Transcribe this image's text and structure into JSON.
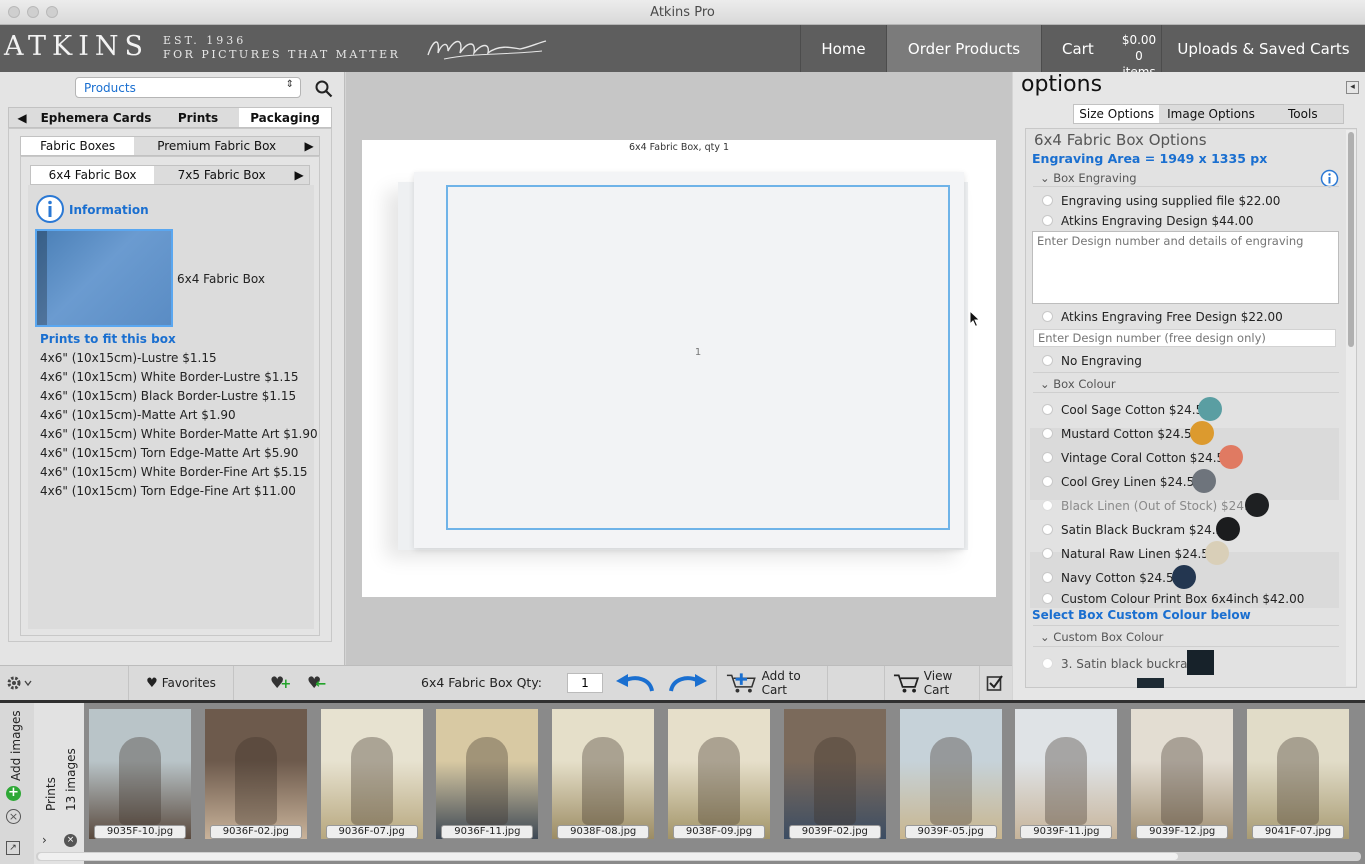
{
  "window": {
    "title": "Atkins Pro"
  },
  "header": {
    "logo": "ATKINS",
    "tagline1": "EST. 1936",
    "tagline2": "FOR PICTURES THAT MATTER",
    "nav": {
      "home": "Home",
      "order": "Order Products",
      "cart": "Cart",
      "cart_total": "$0.00",
      "cart_items": "0 items",
      "uploads": "Uploads & Saved Carts"
    }
  },
  "left": {
    "category_select": "Products",
    "top_tabs": [
      "Ephemera Cards",
      "Prints",
      "Packaging"
    ],
    "sub_tabs": [
      "Fabric Boxes",
      "Premium Fabric Box"
    ],
    "size_tabs": [
      "6x4 Fabric Box",
      "7x5 Fabric  Box"
    ],
    "info_label": "Information",
    "product_name": "6x4 Fabric Box",
    "prints_heading": "Prints to fit this box",
    "prints": [
      "4x6\" (10x15cm)-Lustre $1.15",
      "4x6\" (10x15cm) White Border-Lustre $1.15",
      "4x6\" (10x15cm) Black Border-Lustre $1.15",
      "4x6\" (10x15cm)-Matte Art $1.90",
      "4x6\" (10x15cm) White Border-Matte Art $1.90",
      "4x6\" (10x15cm) Torn Edge-Matte Art $5.90",
      "4x6\" (10x15cm) White Border-Fine Art $5.15",
      "4x6\" (10x15cm) Torn Edge-Fine Art $11.00"
    ],
    "favorites": "Favorites"
  },
  "center": {
    "caption": "6x4 Fabric Box, qty 1",
    "slot_number": "1"
  },
  "toolbar": {
    "qty_label": "6x4 Fabric Box Qty:",
    "qty_value": "1",
    "add_to_cart": "Add to Cart",
    "view_cart": "View Cart"
  },
  "options": {
    "title": "options",
    "tabs": [
      "Size Options",
      "Image Options",
      "Tools"
    ],
    "heading": "6x4 Fabric Box Options",
    "engraving_area": "Engraving Area = 1949 x 1335 px",
    "section_engraving": "Box Engraving",
    "engraving": [
      "Engraving using supplied file $22.00",
      "Atkins Engraving Design $44.00"
    ],
    "engraving_placeholder": "Enter Design number and details of engraving",
    "free_design": "Atkins Engraving Free Design $22.00",
    "free_placeholder": "Enter Design number (free design only)",
    "no_engraving": "No Engraving",
    "section_colour": "Box Colour",
    "colours": [
      {
        "label": "Cool Sage Cotton $24.50",
        "color": "#5a9ea2"
      },
      {
        "label": "Mustard Cotton $24.50",
        "color": "#dc9a2e"
      },
      {
        "label": "Vintage Coral Cotton $24.50",
        "color": "#e07a62"
      },
      {
        "label": "Cool Grey Linen $24.50",
        "color": "#6e747c"
      },
      {
        "label": "Black Linen (Out of Stock) $24.50",
        "color": "#1e2022"
      },
      {
        "label": "Satin Black Buckram $24.50",
        "color": "#1b1c1e"
      },
      {
        "label": "Natural Raw Linen $24.50",
        "color": "#d9cfb8"
      },
      {
        "label": "Navy Cotton $24.50",
        "color": "#233650"
      }
    ],
    "custom_print": "Custom Colour Print Box 6x4inch $42.00",
    "custom_select": "Select Box Custom Colour below",
    "section_custom": "Custom Box Colour",
    "custom_item": "3. Satin black buckram"
  },
  "filmstrip": {
    "add_images": "Add images",
    "group": "Prints",
    "count": "13 images",
    "images": [
      {
        "name": "9035F-10.jpg",
        "c1": "#b9c4c8",
        "c2": "#5a4a3e"
      },
      {
        "name": "9036F-02.jpg",
        "c1": "#6d5a4c",
        "c2": "#c9b39a"
      },
      {
        "name": "9036F-07.jpg",
        "c1": "#e7e2d0",
        "c2": "#b7a77e"
      },
      {
        "name": "9036F-11.jpg",
        "c1": "#d8c9a3",
        "c2": "#3d4855"
      },
      {
        "name": "9038F-08.jpg",
        "c1": "#e5dfc9",
        "c2": "#9c8c64"
      },
      {
        "name": "9038F-09.jpg",
        "c1": "#e6dfca",
        "c2": "#a29468"
      },
      {
        "name": "9039F-02.jpg",
        "c1": "#7b6a5b",
        "c2": "#3c4d63"
      },
      {
        "name": "9039F-05.jpg",
        "c1": "#c6d2d9",
        "c2": "#c9b68f"
      },
      {
        "name": "9039F-11.jpg",
        "c1": "#dfe3e6",
        "c2": "#c7b49a"
      },
      {
        "name": "9039F-12.jpg",
        "c1": "#e3ddd2",
        "c2": "#a08f72"
      },
      {
        "name": "9041F-07.jpg",
        "c1": "#e1dcc8",
        "c2": "#a89b73"
      }
    ]
  }
}
